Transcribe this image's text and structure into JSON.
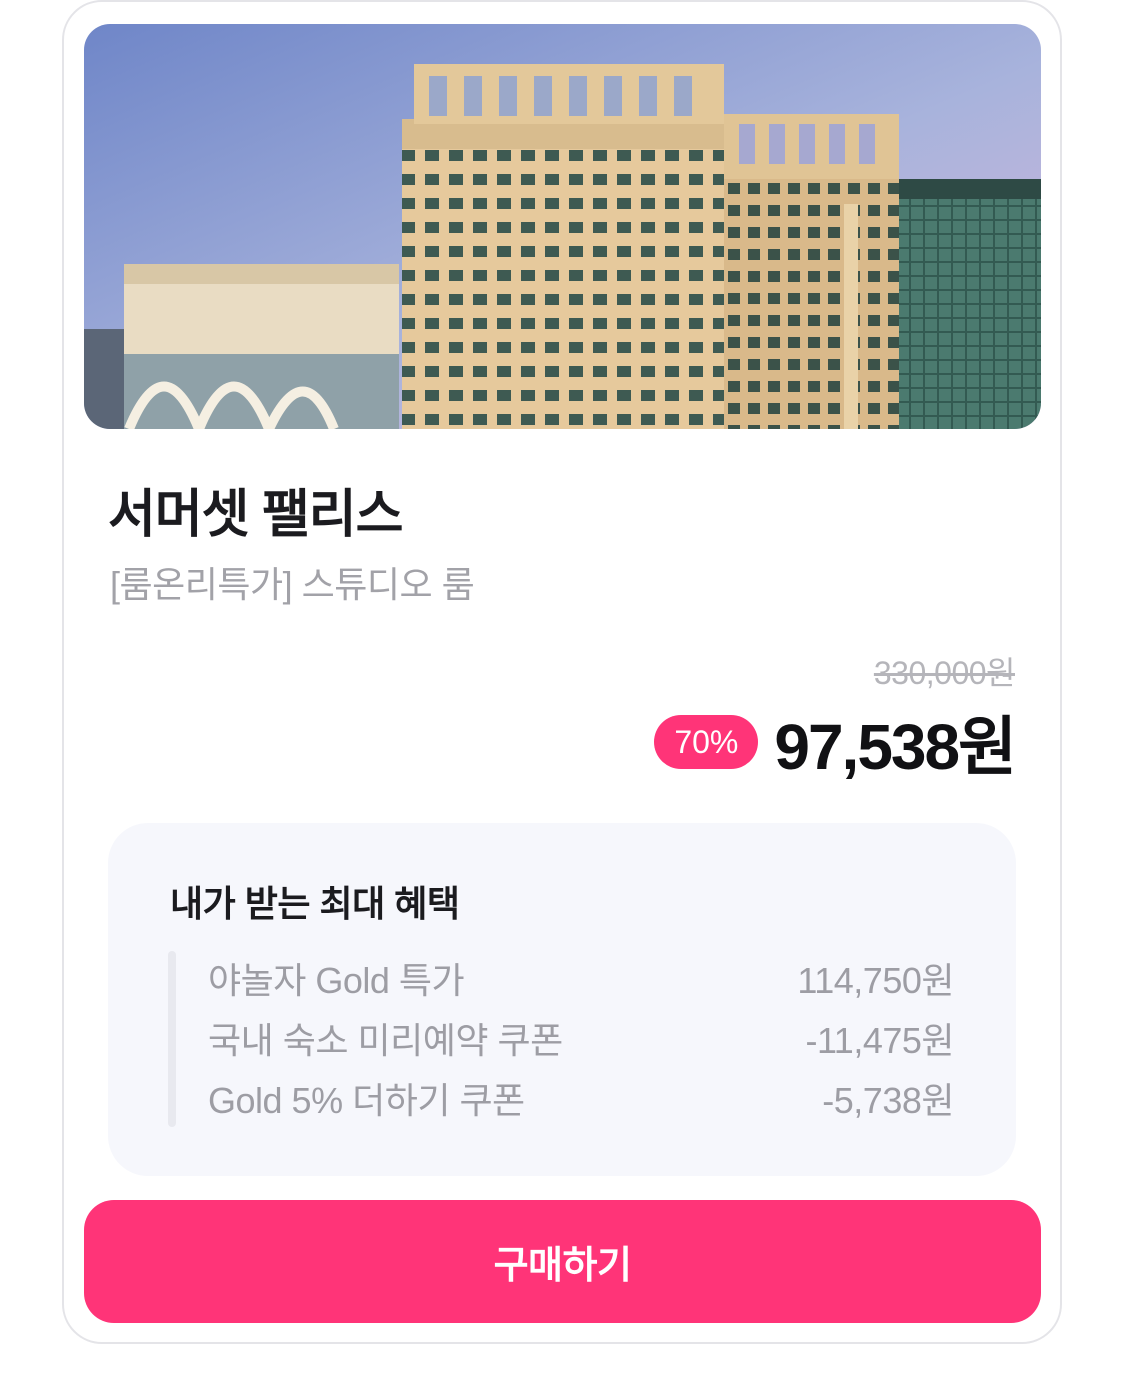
{
  "product": {
    "hotel_name": "서머셋 팰리스",
    "room_name": "[룸온리특가] 스튜디오 룸",
    "original_price": "330,000원",
    "discount": "70%",
    "final_price": "97,538원"
  },
  "benefits": {
    "title": "내가 받는 최대 혜택",
    "items": [
      {
        "label": "야놀자 Gold 특가",
        "amount": "114,750원"
      },
      {
        "label": "국내 숙소 미리예약 쿠폰",
        "amount": "-11,475원"
      },
      {
        "label": "Gold 5% 더하기 쿠폰",
        "amount": "-5,738원"
      }
    ]
  },
  "actions": {
    "buy_label": "구매하기"
  },
  "colors": {
    "accent": "#ff3478",
    "benefit_bg": "#f6f7fc"
  }
}
